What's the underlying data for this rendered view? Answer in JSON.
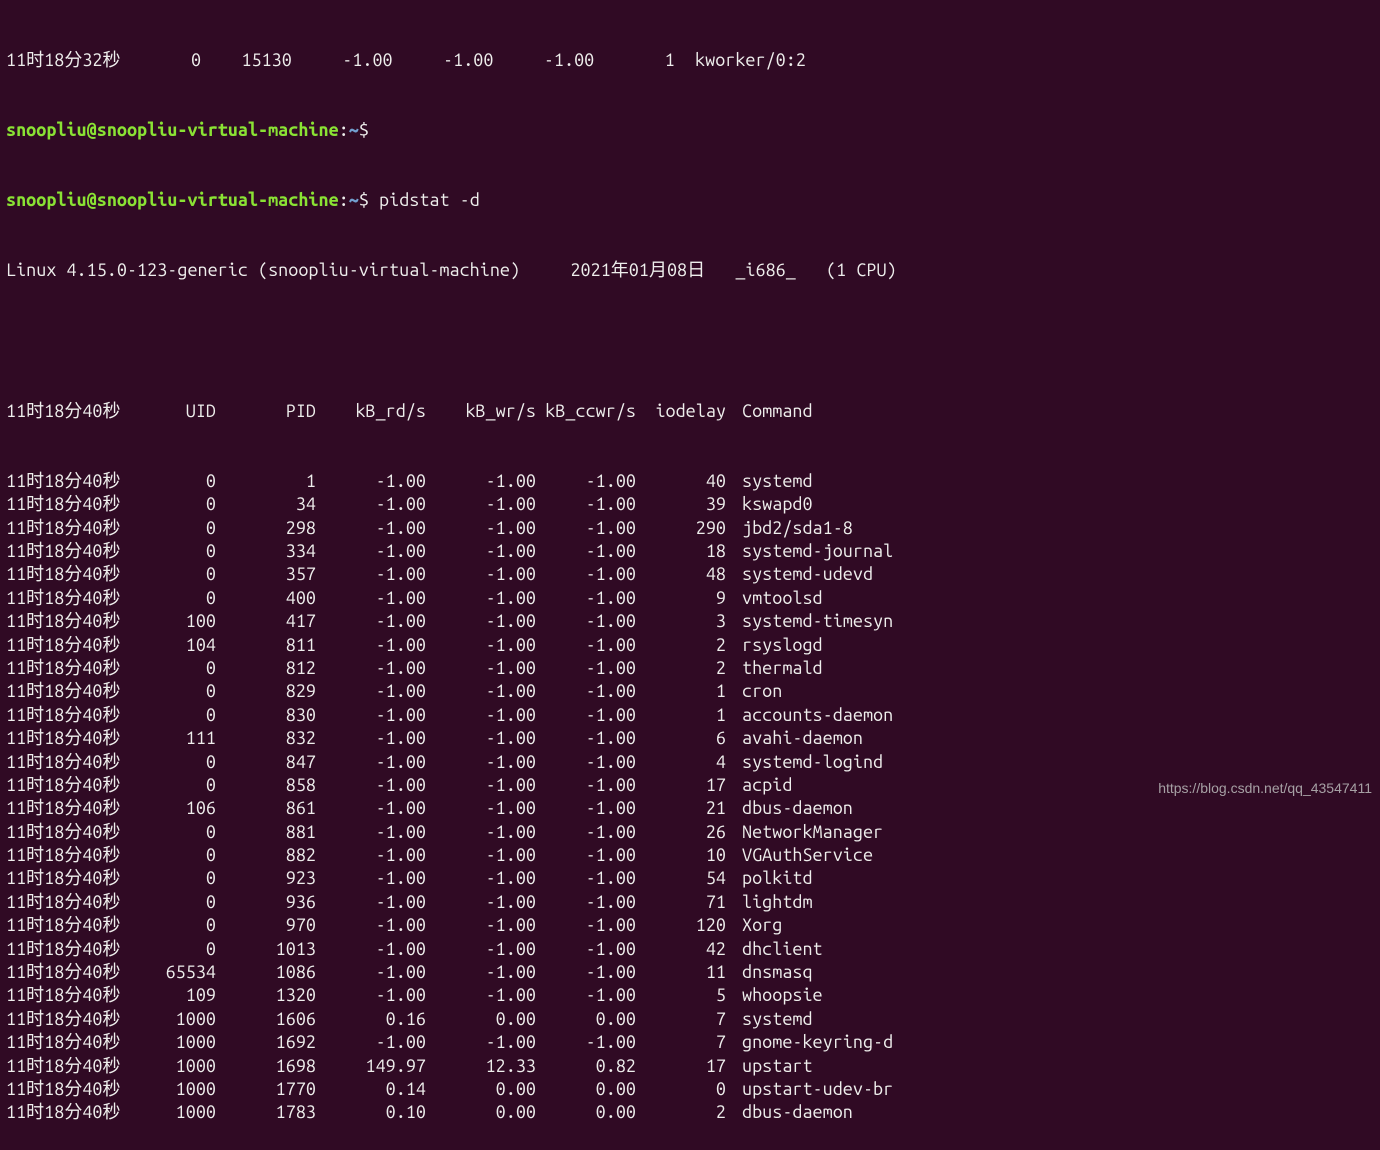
{
  "top_fragment": "11时18分32秒       0    15130     -1.00     -1.00     -1.00       1  kworker/0:2",
  "prompt": {
    "user": "snoopliu",
    "at": "@",
    "host": "snoopliu-virtual-machine",
    "colon": ":",
    "path": "~",
    "dollar": "$"
  },
  "command": "pidstat -d",
  "sysline": "Linux 4.15.0-123-generic (snoopliu-virtual-machine)     2021年01月08日   _i686_   (1 CPU)",
  "headers": {
    "time": "11时18分40秒",
    "uid": "UID",
    "pid": "PID",
    "kb_rd": "kB_rd/s",
    "kb_wr": "kB_wr/s",
    "kb_ccwr": "kB_ccwr/s",
    "iodelay": "iodelay",
    "command": "Command"
  },
  "rows": [
    {
      "time": "11时18分40秒",
      "uid": "0",
      "pid": "1",
      "kb_rd": "-1.00",
      "kb_wr": "-1.00",
      "kb_ccwr": "-1.00",
      "iodelay": "40",
      "command": "systemd"
    },
    {
      "time": "11时18分40秒",
      "uid": "0",
      "pid": "34",
      "kb_rd": "-1.00",
      "kb_wr": "-1.00",
      "kb_ccwr": "-1.00",
      "iodelay": "39",
      "command": "kswapd0"
    },
    {
      "time": "11时18分40秒",
      "uid": "0",
      "pid": "298",
      "kb_rd": "-1.00",
      "kb_wr": "-1.00",
      "kb_ccwr": "-1.00",
      "iodelay": "290",
      "command": "jbd2/sda1-8"
    },
    {
      "time": "11时18分40秒",
      "uid": "0",
      "pid": "334",
      "kb_rd": "-1.00",
      "kb_wr": "-1.00",
      "kb_ccwr": "-1.00",
      "iodelay": "18",
      "command": "systemd-journal"
    },
    {
      "time": "11时18分40秒",
      "uid": "0",
      "pid": "357",
      "kb_rd": "-1.00",
      "kb_wr": "-1.00",
      "kb_ccwr": "-1.00",
      "iodelay": "48",
      "command": "systemd-udevd"
    },
    {
      "time": "11时18分40秒",
      "uid": "0",
      "pid": "400",
      "kb_rd": "-1.00",
      "kb_wr": "-1.00",
      "kb_ccwr": "-1.00",
      "iodelay": "9",
      "command": "vmtoolsd"
    },
    {
      "time": "11时18分40秒",
      "uid": "100",
      "pid": "417",
      "kb_rd": "-1.00",
      "kb_wr": "-1.00",
      "kb_ccwr": "-1.00",
      "iodelay": "3",
      "command": "systemd-timesyn"
    },
    {
      "time": "11时18分40秒",
      "uid": "104",
      "pid": "811",
      "kb_rd": "-1.00",
      "kb_wr": "-1.00",
      "kb_ccwr": "-1.00",
      "iodelay": "2",
      "command": "rsyslogd"
    },
    {
      "time": "11时18分40秒",
      "uid": "0",
      "pid": "812",
      "kb_rd": "-1.00",
      "kb_wr": "-1.00",
      "kb_ccwr": "-1.00",
      "iodelay": "2",
      "command": "thermald"
    },
    {
      "time": "11时18分40秒",
      "uid": "0",
      "pid": "829",
      "kb_rd": "-1.00",
      "kb_wr": "-1.00",
      "kb_ccwr": "-1.00",
      "iodelay": "1",
      "command": "cron"
    },
    {
      "time": "11时18分40秒",
      "uid": "0",
      "pid": "830",
      "kb_rd": "-1.00",
      "kb_wr": "-1.00",
      "kb_ccwr": "-1.00",
      "iodelay": "1",
      "command": "accounts-daemon"
    },
    {
      "time": "11时18分40秒",
      "uid": "111",
      "pid": "832",
      "kb_rd": "-1.00",
      "kb_wr": "-1.00",
      "kb_ccwr": "-1.00",
      "iodelay": "6",
      "command": "avahi-daemon"
    },
    {
      "time": "11时18分40秒",
      "uid": "0",
      "pid": "847",
      "kb_rd": "-1.00",
      "kb_wr": "-1.00",
      "kb_ccwr": "-1.00",
      "iodelay": "4",
      "command": "systemd-logind"
    },
    {
      "time": "11时18分40秒",
      "uid": "0",
      "pid": "858",
      "kb_rd": "-1.00",
      "kb_wr": "-1.00",
      "kb_ccwr": "-1.00",
      "iodelay": "17",
      "command": "acpid"
    },
    {
      "time": "11时18分40秒",
      "uid": "106",
      "pid": "861",
      "kb_rd": "-1.00",
      "kb_wr": "-1.00",
      "kb_ccwr": "-1.00",
      "iodelay": "21",
      "command": "dbus-daemon"
    },
    {
      "time": "11时18分40秒",
      "uid": "0",
      "pid": "881",
      "kb_rd": "-1.00",
      "kb_wr": "-1.00",
      "kb_ccwr": "-1.00",
      "iodelay": "26",
      "command": "NetworkManager"
    },
    {
      "time": "11时18分40秒",
      "uid": "0",
      "pid": "882",
      "kb_rd": "-1.00",
      "kb_wr": "-1.00",
      "kb_ccwr": "-1.00",
      "iodelay": "10",
      "command": "VGAuthService"
    },
    {
      "time": "11时18分40秒",
      "uid": "0",
      "pid": "923",
      "kb_rd": "-1.00",
      "kb_wr": "-1.00",
      "kb_ccwr": "-1.00",
      "iodelay": "54",
      "command": "polkitd"
    },
    {
      "time": "11时18分40秒",
      "uid": "0",
      "pid": "936",
      "kb_rd": "-1.00",
      "kb_wr": "-1.00",
      "kb_ccwr": "-1.00",
      "iodelay": "71",
      "command": "lightdm"
    },
    {
      "time": "11时18分40秒",
      "uid": "0",
      "pid": "970",
      "kb_rd": "-1.00",
      "kb_wr": "-1.00",
      "kb_ccwr": "-1.00",
      "iodelay": "120",
      "command": "Xorg"
    },
    {
      "time": "11时18分40秒",
      "uid": "0",
      "pid": "1013",
      "kb_rd": "-1.00",
      "kb_wr": "-1.00",
      "kb_ccwr": "-1.00",
      "iodelay": "42",
      "command": "dhclient"
    },
    {
      "time": "11时18分40秒",
      "uid": "65534",
      "pid": "1086",
      "kb_rd": "-1.00",
      "kb_wr": "-1.00",
      "kb_ccwr": "-1.00",
      "iodelay": "11",
      "command": "dnsmasq"
    },
    {
      "time": "11时18分40秒",
      "uid": "109",
      "pid": "1320",
      "kb_rd": "-1.00",
      "kb_wr": "-1.00",
      "kb_ccwr": "-1.00",
      "iodelay": "5",
      "command": "whoopsie"
    },
    {
      "time": "11时18分40秒",
      "uid": "1000",
      "pid": "1606",
      "kb_rd": "0.16",
      "kb_wr": "0.00",
      "kb_ccwr": "0.00",
      "iodelay": "7",
      "command": "systemd"
    },
    {
      "time": "11时18分40秒",
      "uid": "1000",
      "pid": "1692",
      "kb_rd": "-1.00",
      "kb_wr": "-1.00",
      "kb_ccwr": "-1.00",
      "iodelay": "7",
      "command": "gnome-keyring-d"
    },
    {
      "time": "11时18分40秒",
      "uid": "1000",
      "pid": "1698",
      "kb_rd": "149.97",
      "kb_wr": "12.33",
      "kb_ccwr": "0.82",
      "iodelay": "17",
      "command": "upstart"
    },
    {
      "time": "11时18分40秒",
      "uid": "1000",
      "pid": "1770",
      "kb_rd": "0.14",
      "kb_wr": "0.00",
      "kb_ccwr": "0.00",
      "iodelay": "0",
      "command": "upstart-udev-br"
    },
    {
      "time": "11时18分40秒",
      "uid": "1000",
      "pid": "1783",
      "kb_rd": "0.10",
      "kb_wr": "0.00",
      "kb_ccwr": "0.00",
      "iodelay": "2",
      "command": "dbus-daemon"
    }
  ],
  "watermark": "https://blog.csdn.net/qq_43547411"
}
